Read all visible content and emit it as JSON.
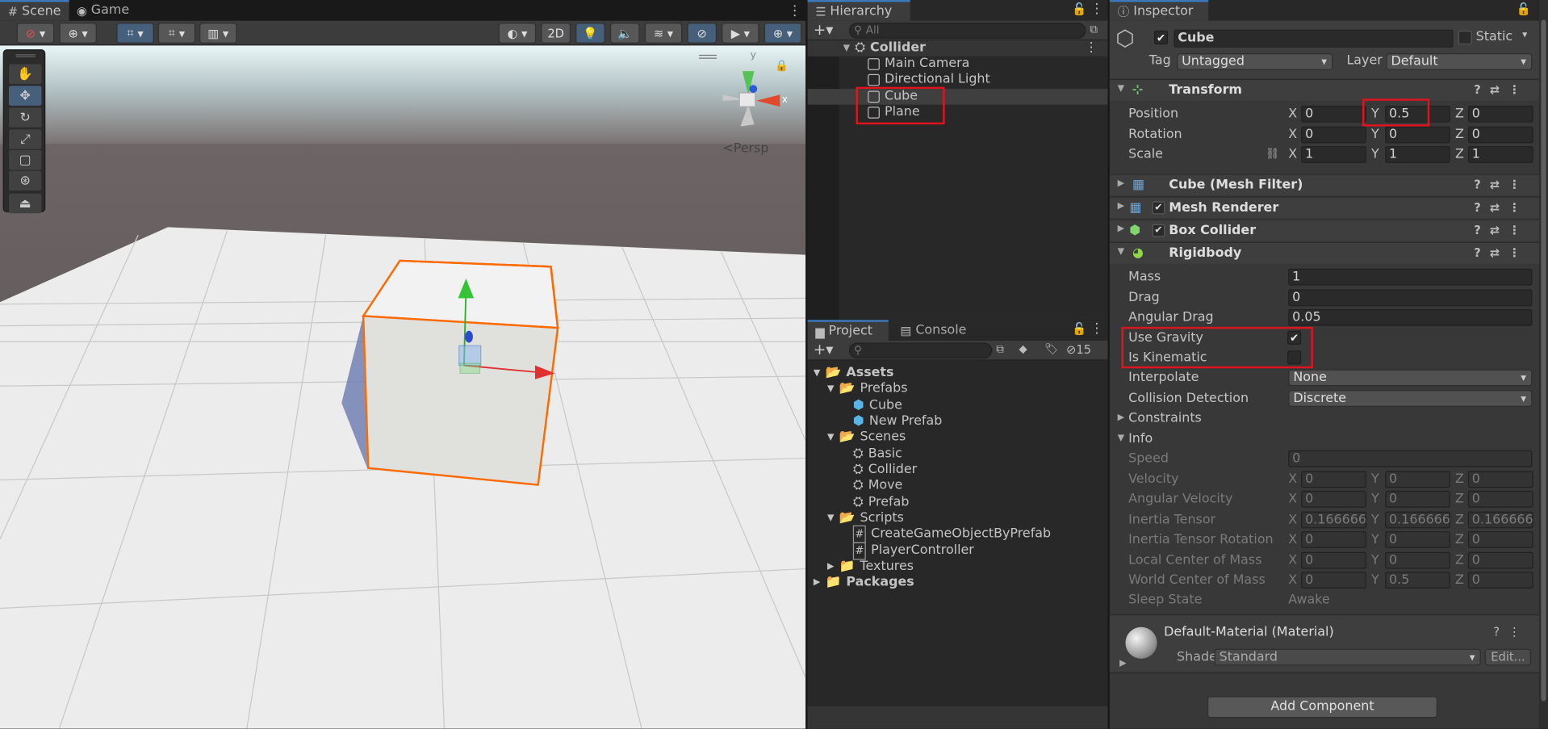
{
  "scene": {
    "tabs": [
      {
        "label": "Scene"
      },
      {
        "label": "Game"
      }
    ],
    "toolbar": {
      "mode_2d": "2D"
    },
    "persp_label": "<Persp",
    "gizmo": {
      "y": "y",
      "x": "x"
    }
  },
  "hierarchy": {
    "tab": "Hierarchy",
    "search_placeholder": "All",
    "root": "Collider",
    "items": [
      "Main Camera",
      "Directional Light",
      "Cube",
      "Plane"
    ]
  },
  "project": {
    "tabs": [
      {
        "label": "Project"
      },
      {
        "label": "Console"
      }
    ],
    "hidden_count": "15",
    "tree": {
      "assets": "Assets",
      "prefabs": "Prefabs",
      "prefab_items": [
        "Cube",
        "New Prefab"
      ],
      "scenes": "Scenes",
      "scene_items": [
        "Basic",
        "Collider",
        "Move",
        "Prefab"
      ],
      "scripts": "Scripts",
      "script_items": [
        "CreateGameObjectByPrefab",
        "PlayerController"
      ],
      "textures": "Textures",
      "packages": "Packages"
    }
  },
  "inspector": {
    "tab": "Inspector",
    "object_name": "Cube",
    "static_label": "Static",
    "tag_label": "Tag",
    "tag_value": "Untagged",
    "layer_label": "Layer",
    "layer_value": "Default",
    "transform": {
      "title": "Transform",
      "position_label": "Position",
      "position": [
        "0",
        "0.5",
        "0"
      ],
      "rotation_label": "Rotation",
      "rotation": [
        "0",
        "0",
        "0"
      ],
      "scale_label": "Scale",
      "scale": [
        "1",
        "1",
        "1"
      ],
      "axes": [
        "X",
        "Y",
        "Z"
      ]
    },
    "mesh_filter": "Cube (Mesh Filter)",
    "mesh_renderer": "Mesh Renderer",
    "box_collider": "Box Collider",
    "rigidbody": {
      "title": "Rigidbody",
      "mass_label": "Mass",
      "mass": "1",
      "drag_label": "Drag",
      "drag": "0",
      "angular_drag_label": "Angular Drag",
      "angular_drag": "0.05",
      "use_gravity_label": "Use Gravity",
      "use_gravity": "✔",
      "is_kinematic_label": "Is Kinematic",
      "interpolate_label": "Interpolate",
      "interpolate": "None",
      "collision_label": "Collision Detection",
      "collision": "Discrete",
      "constraints_label": "Constraints",
      "info_label": "Info",
      "speed_label": "Speed",
      "speed": "0",
      "velocity_label": "Velocity",
      "velocity": [
        "0",
        "0",
        "0"
      ],
      "ang_velocity_label": "Angular Velocity",
      "ang_velocity": [
        "0",
        "0",
        "0"
      ],
      "inertia_label": "Inertia Tensor",
      "inertia": [
        "0.166666",
        "0.166666",
        "0.166666"
      ],
      "inertia_rot_label": "Inertia Tensor Rotation",
      "inertia_rot": [
        "0",
        "0",
        "0"
      ],
      "local_com_label": "Local Center of Mass",
      "local_com": [
        "0",
        "0",
        "0"
      ],
      "world_com_label": "World Center of Mass",
      "world_com": [
        "0",
        "0.5",
        "0"
      ],
      "sleep_label": "Sleep State",
      "sleep": "Awake"
    },
    "material": {
      "name": "Default-Material (Material)",
      "shader_label": "Shader",
      "shader": "Standard",
      "edit": "Edit..."
    },
    "add_component": "Add Component"
  },
  "colors": {
    "accent": "#3a79bb",
    "highlight": "#e0141e",
    "selection": "#ff6a00"
  }
}
